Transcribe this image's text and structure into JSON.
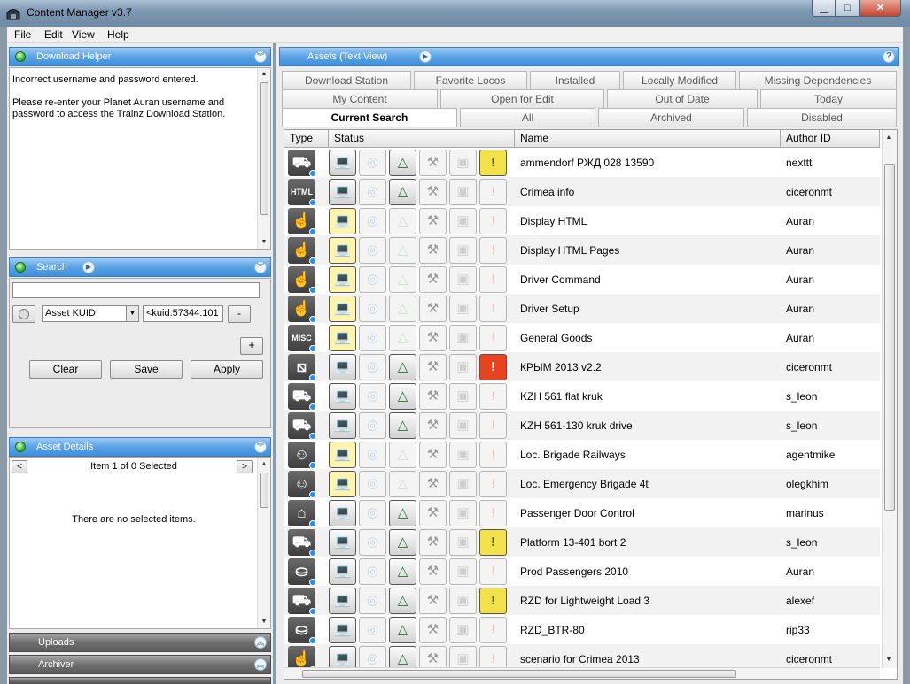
{
  "window": {
    "title": "Content Manager v3.7"
  },
  "menu": [
    "File",
    "Edit",
    "View",
    "Help"
  ],
  "download_helper": {
    "title": "Download Helper",
    "line1": "Incorrect username and password entered.",
    "line2": "Please re-enter your Planet Auran username and",
    "line3": "password to access the Trainz Download Station."
  },
  "search": {
    "title": "Search",
    "query_value": "",
    "field_select": "Asset KUID",
    "kuid_value": "<kuid:57344:101",
    "minus_label": "-",
    "plus_label": "+",
    "clear_label": "Clear",
    "save_label": "Save",
    "apply_label": "Apply"
  },
  "asset_details": {
    "title": "Asset Details",
    "nav_prev": "<",
    "nav_next": ">",
    "counter": "Item 1 of 0 Selected",
    "empty_text": "There are no selected items."
  },
  "collapsed_panels": [
    "Uploads",
    "Archiver"
  ],
  "assets_panel": {
    "title": "Assets (Text View)",
    "help": "?"
  },
  "tabs": {
    "row1": [
      "Download Station",
      "Favorite Locos",
      "Installed",
      "Locally Modified",
      "Missing Dependencies"
    ],
    "row2": [
      "My Content",
      "Open for Edit",
      "Out of Date",
      "Today"
    ],
    "row3": [
      "Current Search",
      "All",
      "Archived",
      "Disabled"
    ],
    "active": "Current Search"
  },
  "columns": {
    "type": "Type",
    "status": "Status",
    "name": "Name",
    "author": "Author ID"
  },
  "colors": {
    "accent": "#3f8fdc",
    "status_ok": "#1f7a2e",
    "warning": "#f2e14a",
    "error": "#e8431f"
  },
  "rows": [
    {
      "type": "truck-icon",
      "name": "ammendorf РЖД 028 13590",
      "author": "nexttt",
      "lock": "normal",
      "installed": true,
      "warn": "warning",
      "modified": false
    },
    {
      "type": "HTML",
      "name": "Crimea info",
      "author": "ciceronmt",
      "lock": "normal",
      "installed": true,
      "warn": "none",
      "modified": false
    },
    {
      "type": "hand-icon",
      "name": "Display HTML",
      "author": "Auran",
      "lock": "built-in",
      "installed": false,
      "warn": "none",
      "modified": false
    },
    {
      "type": "hand-icon",
      "name": "Display HTML Pages",
      "author": "Auran",
      "lock": "built-in",
      "installed": false,
      "warn": "none",
      "modified": false
    },
    {
      "type": "hand-icon",
      "name": "Driver Command",
      "author": "Auran",
      "lock": "built-in-locked",
      "installed": false,
      "warn": "none",
      "modified": false
    },
    {
      "type": "hand-icon",
      "name": "Driver Setup",
      "author": "Auran",
      "lock": "built-in-locked",
      "installed": false,
      "warn": "none",
      "modified": false
    },
    {
      "type": "MISC",
      "name": "General Goods",
      "author": "Auran",
      "lock": "built-in-locked",
      "installed": false,
      "warn": "none",
      "modified": false
    },
    {
      "type": "track-icon",
      "name": "КРЫМ 2013 v2.2",
      "author": "ciceronmt",
      "lock": "normal",
      "installed": true,
      "warn": "error",
      "modified": false
    },
    {
      "type": "truck-icon",
      "name": "KZH 561 flat kruk",
      "author": "s_leon",
      "lock": "normal",
      "installed": true,
      "warn": "none",
      "modified": false
    },
    {
      "type": "truck-icon",
      "name": "KZH 561-130 kruk drive",
      "author": "s_leon",
      "lock": "normal",
      "installed": true,
      "warn": "none",
      "modified": false
    },
    {
      "type": "driver-icon",
      "name": "Loc. Brigade Railways",
      "author": "agentmike",
      "lock": "built-in",
      "installed": false,
      "warn": "none",
      "modified": false
    },
    {
      "type": "driver-icon",
      "name": "Loc. Emergency Brigade 4t",
      "author": "olegkhim",
      "lock": "built-in",
      "installed": false,
      "warn": "none",
      "modified": false
    },
    {
      "type": "door-icon",
      "name": "Passenger Door Control",
      "author": "marinus",
      "lock": "normal",
      "installed": true,
      "warn": "none",
      "modified": false
    },
    {
      "type": "truck-icon",
      "name": "Platform 13-401 bort 2",
      "author": "s_leon",
      "lock": "normal",
      "installed": true,
      "warn": "warning",
      "modified": false
    },
    {
      "type": "barrel-icon",
      "name": "Prod Passengers 2010",
      "author": "Auran",
      "lock": "normal",
      "installed": true,
      "warn": "none",
      "modified": false
    },
    {
      "type": "truck-icon",
      "name": "RZD for Lightweight Load 3",
      "author": "alexef",
      "lock": "normal",
      "installed": true,
      "warn": "warning",
      "modified": false
    },
    {
      "type": "barrel-icon",
      "name": "RZD_BTR-80",
      "author": "rip33",
      "lock": "normal",
      "installed": true,
      "warn": "none",
      "modified": false
    },
    {
      "type": "hand-icon",
      "name": "scenario for Crimea 2013",
      "author": "ciceronmt",
      "lock": "normal",
      "installed": true,
      "warn": "none",
      "modified": false
    }
  ]
}
